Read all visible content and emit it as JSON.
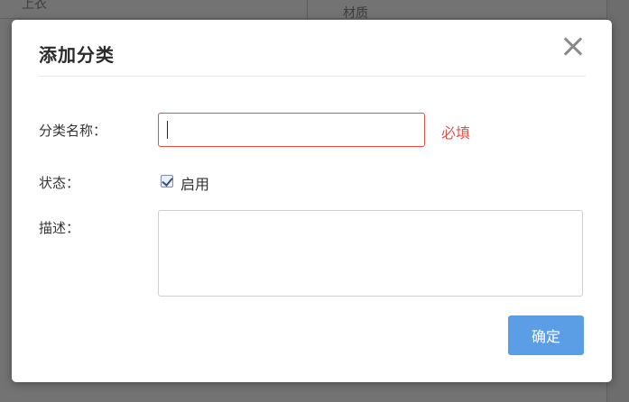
{
  "background": {
    "left_cell": "上衣",
    "right_cell": "材质"
  },
  "dialog": {
    "title": "添加分类",
    "fields": {
      "name_label": "分类名称：",
      "name_value": "",
      "name_required": "必填",
      "status_label": "状态：",
      "status_checkbox_label": "启用",
      "status_checked": true,
      "description_label": "描述：",
      "description_value": ""
    },
    "confirm_label": "确定"
  },
  "colors": {
    "accent_button": "#5b9ee6",
    "error_red": "#d9534f"
  }
}
